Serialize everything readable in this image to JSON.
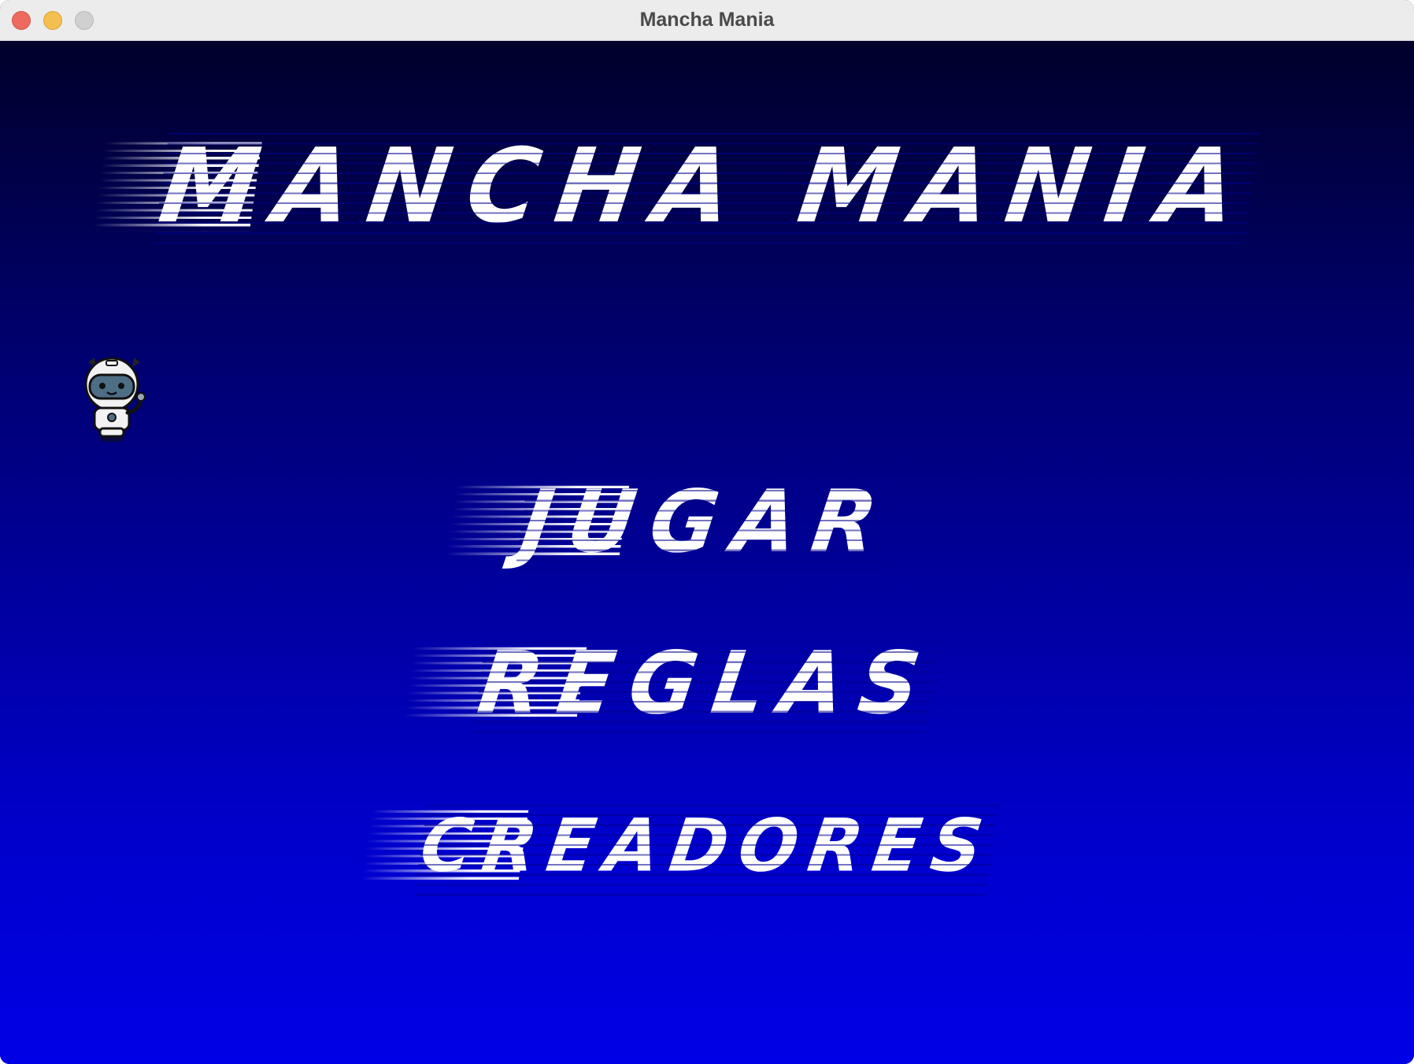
{
  "window": {
    "title": "Mancha Mania"
  },
  "game": {
    "title": "Mancha Mania",
    "menu": [
      {
        "label": "Jugar"
      },
      {
        "label": "Reglas"
      },
      {
        "label": "Creadores"
      }
    ],
    "character_icon": "robot-astronaut-icon",
    "colors": {
      "background_top": "#00002a",
      "background_bottom": "#0000e6",
      "text": "#ffffff"
    }
  }
}
